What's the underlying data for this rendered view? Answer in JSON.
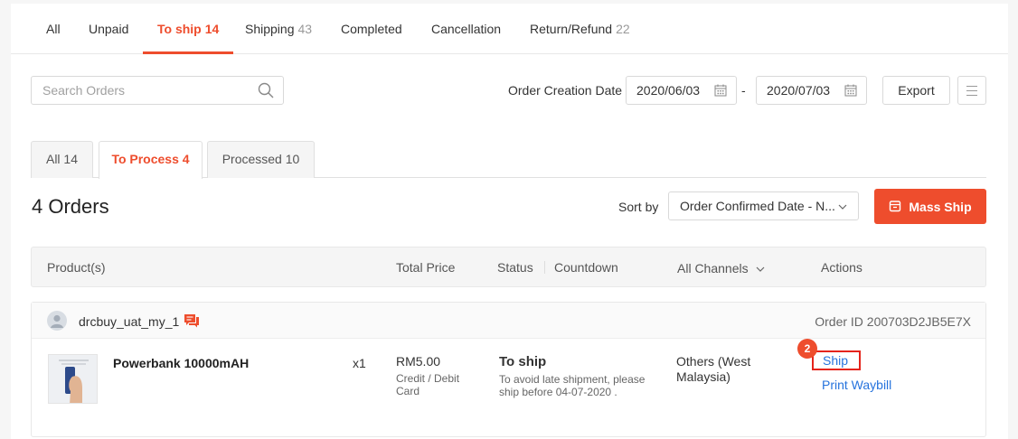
{
  "top_tabs": [
    {
      "label": "All",
      "count": ""
    },
    {
      "label": "Unpaid",
      "count": ""
    },
    {
      "label": "To ship",
      "count": "14"
    },
    {
      "label": "Shipping",
      "count": "43"
    },
    {
      "label": "Completed",
      "count": ""
    },
    {
      "label": "Cancellation",
      "count": ""
    },
    {
      "label": "Return/Refund",
      "count": "22"
    }
  ],
  "search": {
    "placeholder": "Search Orders"
  },
  "date_filter": {
    "label": "Order Creation Date",
    "from": "2020/06/03",
    "separator": "-",
    "to": "2020/07/03"
  },
  "toolbar": {
    "export_label": "Export"
  },
  "sub_tabs": [
    {
      "label": "All 14"
    },
    {
      "label": "To Process 4"
    },
    {
      "label": "Processed 10"
    }
  ],
  "orders_count": "4 Orders",
  "sort": {
    "label": "Sort by",
    "value": "Order Confirmed Date - N..."
  },
  "mass_ship_label": "Mass Ship",
  "table_header": {
    "product": "Product(s)",
    "total_price": "Total Price",
    "status": "Status",
    "countdown": "Countdown",
    "channels": "All Channels",
    "actions": "Actions"
  },
  "order": {
    "buyer": "drcbuy_uat_my_1",
    "order_id": "Order ID 200703D2JB5E7X",
    "product_name": "Powerbank 10000mAH",
    "quantity": "x1",
    "price": "RM5.00",
    "payment": "Credit / Debit Card",
    "status_title": "To ship",
    "status_desc": "To avoid late shipment, please ship before 04-07-2020 .",
    "channel": "Others (West Malaysia)",
    "ship_label": "Ship",
    "print_label": "Print Waybill",
    "step_badge": "2"
  },
  "colors": {
    "accent": "#ee4d2d",
    "link": "#2673dd",
    "highlight_border": "#e5241b"
  },
  "icons": [
    "search-icon",
    "calendar-icon",
    "list-menu-icon",
    "chevron-down-icon",
    "box-icon",
    "user-avatar-icon",
    "chat-icon"
  ]
}
